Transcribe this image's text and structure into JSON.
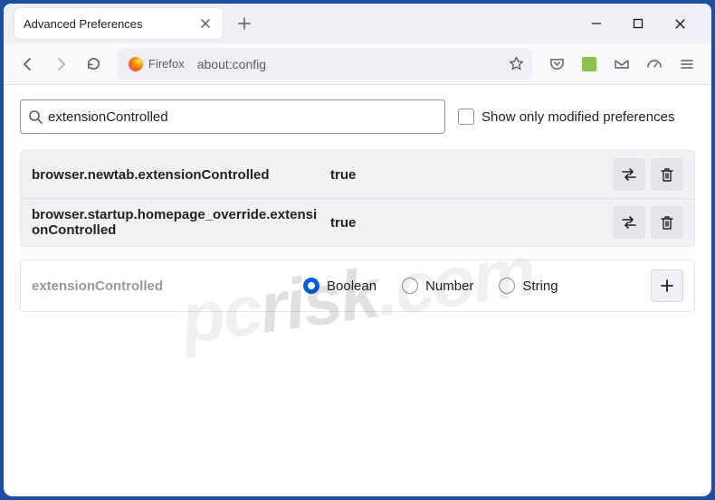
{
  "tab": {
    "title": "Advanced Preferences"
  },
  "urlbar": {
    "identity": "Firefox",
    "url": "about:config"
  },
  "search": {
    "value": "extensionControlled"
  },
  "show_modified_label": "Show only modified preferences",
  "rows": [
    {
      "name": "browser.newtab.extensionControlled",
      "value": "true"
    },
    {
      "name": "browser.startup.homepage_override.extensionControlled",
      "value": "true"
    }
  ],
  "new_pref": {
    "name": "extensionControlled",
    "types": [
      "Boolean",
      "Number",
      "String"
    ],
    "selected": "Boolean"
  },
  "watermark": {
    "pc": "pc",
    "risk": "risk",
    "suffix": ".com"
  }
}
